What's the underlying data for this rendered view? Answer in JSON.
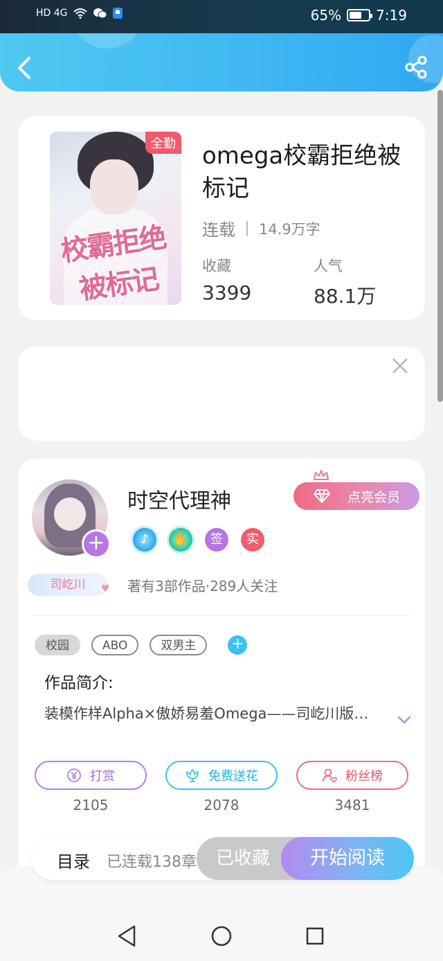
{
  "status_bar": {
    "network": "HD 4G",
    "battery": "65%",
    "battery_level": 0.65,
    "time": "7:19"
  },
  "header": {
    "back_icon": "chevron-left-icon",
    "share_icon": "share-icon"
  },
  "book": {
    "cover_badge": "全勤",
    "cover_title": "校霸拒绝被标记",
    "title": "omega校霸拒绝被标记",
    "status": "连载",
    "word_count": "14.9万字",
    "favorites_label": "收藏",
    "favorites_value": "3399",
    "popularity_label": "人气",
    "popularity_value": "88.1万"
  },
  "ad": {
    "close_icon": "close-icon"
  },
  "author": {
    "name": "时空代理神",
    "pen_name": "司屹川",
    "vip_button": "点亮会员",
    "badges": {
      "sign": "签",
      "real": "实"
    },
    "works_info": "著有3部作品·289人关注"
  },
  "tags": [
    "校园",
    "ABO",
    "双男主"
  ],
  "intro": {
    "title": "作品简介:",
    "text": "装模作样Alpha×傲娇易羞Omega——司屹川版…"
  },
  "actions": [
    {
      "label": "打赏",
      "count": "2105",
      "icon": "yen-icon",
      "color": "#b97ee0"
    },
    {
      "label": "免费送花",
      "count": "2078",
      "icon": "flower-icon",
      "color": "#3cc0ec"
    },
    {
      "label": "粉丝榜",
      "count": "3481",
      "icon": "fans-icon",
      "color": "#ee6d7c"
    }
  ],
  "bottom_bar": {
    "toc_label": "目录",
    "toc_status": "已连载138章",
    "collect_button": "已收藏",
    "read_button": "开始阅读"
  },
  "colors": {
    "header_gradient_start": "#4fc9f1",
    "header_gradient_end": "#2fa8f3",
    "accent_purple": "#b676e3",
    "accent_blue": "#3bc1ef",
    "accent_red": "#ee5e6c"
  }
}
